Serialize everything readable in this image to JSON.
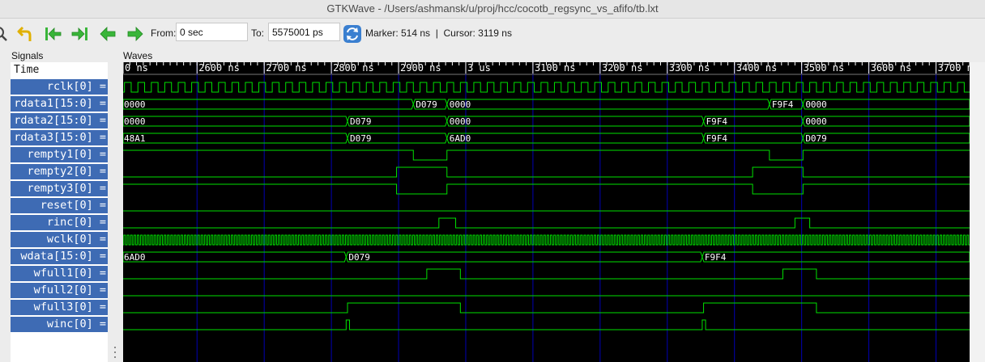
{
  "window": {
    "title": "GTKWave - /Users/ashmansk/u/proj/hcc/cocotb_regsync_vs_afifo/tb.lxt"
  },
  "toolbar": {
    "from_label": "From:",
    "from_value": "0 sec",
    "to_label": "To:",
    "to_value": "5575001 ps",
    "status": "Marker: 514 ns  |  Cursor: 3119 ns",
    "icons": [
      "zoom-icon",
      "undo-icon",
      "jump-start-icon",
      "jump-end-icon",
      "back-arrow-icon",
      "forward-arrow-icon",
      "reload-icon"
    ]
  },
  "panels": {
    "signals_label": "Signals",
    "waves_label": "Waves"
  },
  "signals": {
    "header": "Time",
    "rows": [
      "rclk[0] =",
      "rdata1[15:0] =",
      "rdata2[15:0] =",
      "rdata3[15:0] =",
      "rempty1[0] =",
      "rempty2[0] =",
      "rempty3[0] =",
      "reset[0] =",
      "rinc[0] =",
      "wclk[0] =",
      "wdata[15:0] =",
      "wfull1[0] =",
      "wfull2[0] =",
      "wfull3[0] =",
      "winc[0] ="
    ]
  },
  "waves": {
    "time_range_ns": [
      2490,
      3750
    ],
    "ticks": [
      {
        "t": 2490,
        "label": "0 ns"
      },
      {
        "t": 2600,
        "label": "2600 ns"
      },
      {
        "t": 2700,
        "label": "2700 ns"
      },
      {
        "t": 2800,
        "label": "2800 ns"
      },
      {
        "t": 2900,
        "label": "2900 ns"
      },
      {
        "t": 3000,
        "label": "3 us"
      },
      {
        "t": 3100,
        "label": "3100 ns"
      },
      {
        "t": 3200,
        "label": "3200 ns"
      },
      {
        "t": 3300,
        "label": "3300 ns"
      },
      {
        "t": 3400,
        "label": "3400 ns"
      },
      {
        "t": 3500,
        "label": "3500 ns"
      },
      {
        "t": 3600,
        "label": "3600 ns"
      },
      {
        "t": 3700,
        "label": "3700 ns"
      }
    ],
    "clocks": [
      {
        "row": 0,
        "name": "rclk",
        "period_ns": 20,
        "phase_ns": 2492
      },
      {
        "row": 9,
        "name": "wclk",
        "period_ns": 5,
        "phase_ns": 2491
      }
    ],
    "bits": [
      {
        "row": 4,
        "name": "rempty1",
        "init": 1,
        "edges": [
          2922,
          2972,
          3452,
          3502
        ]
      },
      {
        "row": 5,
        "name": "rempty2",
        "init": 0,
        "edges": [
          2897,
          2972,
          3427,
          3502
        ]
      },
      {
        "row": 6,
        "name": "rempty3",
        "init": 1,
        "edges": [
          2897,
          2972,
          3427,
          3502
        ]
      },
      {
        "row": 7,
        "name": "reset",
        "init": 0,
        "edges": []
      },
      {
        "row": 8,
        "name": "rinc",
        "init": 0,
        "edges": [
          2960,
          2985,
          3490,
          3512
        ]
      },
      {
        "row": 11,
        "name": "wfull1",
        "init": 0,
        "edges": [
          2942,
          2992,
          3472,
          3522
        ]
      },
      {
        "row": 12,
        "name": "wfull2",
        "init": 0,
        "edges": []
      },
      {
        "row": 13,
        "name": "wfull3",
        "init": 0,
        "edges": [
          2824,
          2992,
          3354,
          3522
        ]
      },
      {
        "row": 14,
        "name": "winc",
        "init": 0,
        "edges": [
          2822,
          2827,
          3352,
          3357
        ]
      }
    ],
    "buses": [
      {
        "row": 1,
        "name": "rdata1",
        "segments": [
          {
            "start": 2490,
            "label": "0000"
          },
          {
            "start": 2922,
            "label": "D079"
          },
          {
            "start": 2972,
            "label": "0000"
          },
          {
            "start": 3452,
            "label": "F9F4"
          },
          {
            "start": 3502,
            "label": "0000"
          }
        ]
      },
      {
        "row": 2,
        "name": "rdata2",
        "segments": [
          {
            "start": 2490,
            "label": "0000"
          },
          {
            "start": 2824,
            "label": "D079"
          },
          {
            "start": 2972,
            "label": "0000"
          },
          {
            "start": 3354,
            "label": "F9F4"
          },
          {
            "start": 3502,
            "label": "0000"
          }
        ]
      },
      {
        "row": 3,
        "name": "rdata3",
        "segments": [
          {
            "start": 2490,
            "label": "48A1"
          },
          {
            "start": 2824,
            "label": "D079"
          },
          {
            "start": 2972,
            "label": "6AD0"
          },
          {
            "start": 3354,
            "label": "F9F4"
          },
          {
            "start": 3502,
            "label": "D079"
          }
        ]
      },
      {
        "row": 10,
        "name": "wdata",
        "segments": [
          {
            "start": 2490,
            "label": "6AD0"
          },
          {
            "start": 2822,
            "label": "D079"
          },
          {
            "start": 3352,
            "label": "F9F4"
          }
        ]
      }
    ],
    "colors": {
      "trace": "#00e000",
      "grid": "#0000b4",
      "axis": "#ffffff",
      "label": "#ffffff",
      "background": "#000000"
    }
  }
}
